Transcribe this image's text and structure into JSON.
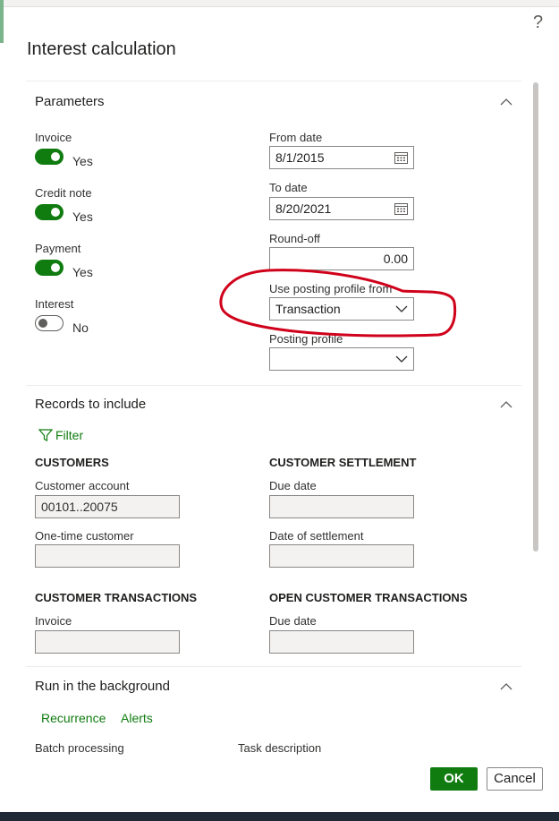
{
  "dialog": {
    "title": "Interest calculation",
    "help_glyph": "?"
  },
  "parameters": {
    "heading": "Parameters",
    "toggles": [
      {
        "label": "Invoice",
        "state": "Yes"
      },
      {
        "label": "Credit note",
        "state": "Yes"
      },
      {
        "label": "Payment",
        "state": "Yes"
      },
      {
        "label": "Interest",
        "state": "No"
      }
    ],
    "from_date": {
      "label": "From date",
      "value": "8/1/2015"
    },
    "to_date": {
      "label": "To date",
      "value": "8/20/2021"
    },
    "round_off": {
      "label": "Round-off",
      "value": "0.00"
    },
    "posting_from": {
      "label": "Use posting profile from",
      "value": "Transaction"
    },
    "posting_profile": {
      "label": "Posting profile",
      "value": ""
    }
  },
  "records": {
    "heading": "Records to include",
    "filter_label": "Filter",
    "customers": {
      "heading": "CUSTOMERS",
      "account_label": "Customer account",
      "account_value": "00101..20075",
      "onetime_label": "One-time customer",
      "onetime_value": ""
    },
    "settlement": {
      "heading": "CUSTOMER SETTLEMENT",
      "due_label": "Due date",
      "due_value": "",
      "date_label": "Date of settlement",
      "date_value": ""
    },
    "transactions": {
      "heading": "CUSTOMER TRANSACTIONS",
      "invoice_label": "Invoice",
      "invoice_value": ""
    },
    "open_transactions": {
      "heading": "OPEN CUSTOMER TRANSACTIONS",
      "due_label": "Due date",
      "due_value": ""
    }
  },
  "background": {
    "heading": "Run in the background",
    "recurrence_label": "Recurrence",
    "alerts_label": "Alerts",
    "batch_label": "Batch processing",
    "task_label": "Task description"
  },
  "buttons": {
    "ok": "OK",
    "cancel": "Cancel"
  },
  "colors": {
    "accent": "#107c10",
    "annotation": "#d0021b"
  }
}
